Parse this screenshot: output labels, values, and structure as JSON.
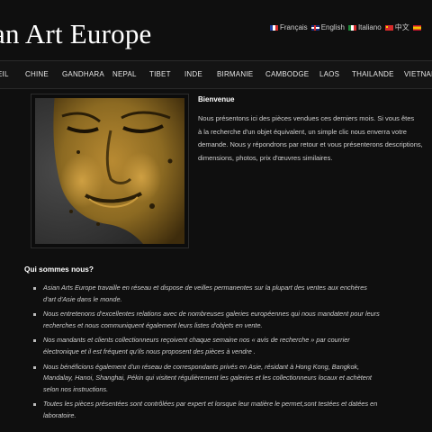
{
  "site": {
    "title": "an Art Europe"
  },
  "languages": [
    {
      "code": "fr",
      "label": "Français"
    },
    {
      "code": "en",
      "label": "English"
    },
    {
      "code": "it",
      "label": "Italiano"
    },
    {
      "code": "cn",
      "label": "中文"
    },
    {
      "code": "es",
      "label": ""
    }
  ],
  "nav": {
    "items": [
      "EIL",
      "CHINE",
      "GANDHARA",
      "NEPAL",
      "TIBET",
      "INDE",
      "BIRMANIE",
      "CAMBODGE",
      "LAOS",
      "THAILANDE",
      "VIETNAM"
    ]
  },
  "welcome": {
    "title": "Bienvenue",
    "lines": [
      "Nous présentons ici des pièces vendues ces derniers mois. Si vous êtes",
      "à la recherche d'un objet équivalent, un simple clic nous enverra votre",
      "demande. Nous y répondrons par retour et vous présenterons descriptions,",
      "dimensions, photos, prix d'œuvres similaires."
    ]
  },
  "about": {
    "title": "Qui sommes nous?",
    "items": [
      [
        "Asian  Arts Europe travaille en réseau et dispose de veilles permanentes sur la plupart des ventes aux enchères",
        "d'art d'Asie dans le monde."
      ],
      [
        "Nous entretenons d'excellentes relations avec de nombreuses galeries européennes qui nous mandatent pour leurs",
        "recherches et nous communiquent également leurs listes d'objets en vente."
      ],
      [
        "Nos mandants et clients collectionneurs reçoivent chaque semaine nos « avis de recherche » par courrier",
        "électronique et il est fréquent qu'ils nous proposent des pièces à vendre ."
      ],
      [
        "Nous bénéficions également d'un réseau de correspondants privés en Asie, résidant à Hong Kong, Bangkok,",
        "Mandalay, Hanoi, Shanghai, Pékin qui visitent régulièrement les galeries et les collectionneurs locaux et achètent",
        "selon nos instructions."
      ],
      [
        "Toutes les pièces présentées sont contrôlées par expert et lorsque leur matière le permet,sont testées et datées en",
        "laboratoire."
      ]
    ]
  }
}
